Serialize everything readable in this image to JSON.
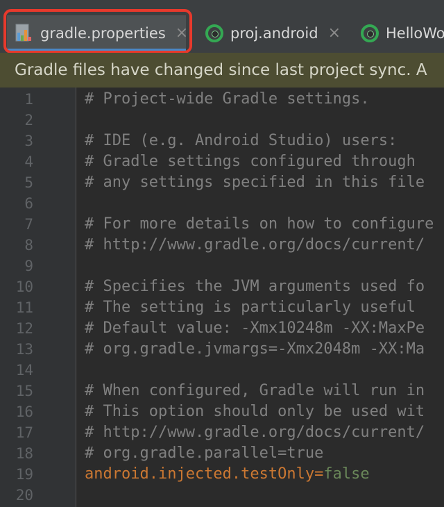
{
  "tabs": [
    {
      "label": "gradle.properties",
      "icon": "properties-file-icon",
      "active": true,
      "highlighted": true
    },
    {
      "label": "proj.android",
      "icon": "android-module-icon",
      "active": false
    },
    {
      "label": "HelloWo",
      "icon": "android-module-icon",
      "active": false
    }
  ],
  "close_glyph": "×",
  "banner": {
    "text": "Gradle files have changed since last project sync. A"
  },
  "code": {
    "line_numbers": [
      "1",
      "2",
      "3",
      "4",
      "5",
      "6",
      "7",
      "8",
      "9",
      "10",
      "11",
      "12",
      "13",
      "14",
      "15",
      "16",
      "17",
      "18",
      "19",
      "20"
    ],
    "lines": [
      "# Project-wide Gradle settings.",
      "",
      "# IDE (e.g. Android Studio) users:",
      "# Gradle settings configured through",
      "# any settings specified in this file",
      "",
      "# For more details on how to configure",
      "# http://www.gradle.org/docs/current/",
      "",
      "# Specifies the JVM arguments used fo",
      "# The setting is particularly useful",
      "# Default value: -Xmx10248m -XX:MaxPe",
      "# org.gradle.jvmargs=-Xmx2048m -XX:Ma",
      "",
      "# When configured, Gradle will run in",
      "# This option should only be used wit",
      "# http://www.gradle.org/docs/current/",
      "# org.gradle.parallel=true",
      "",
      ""
    ],
    "property_line": {
      "key": "android.injected.testOnly",
      "equals": "=",
      "value": "false"
    }
  },
  "colors": {
    "highlight_box": "#e8392c",
    "comment": "#808080",
    "property_key": "#cc7832",
    "property_value": "#6a8759",
    "banner_bg": "#4d4d32"
  }
}
